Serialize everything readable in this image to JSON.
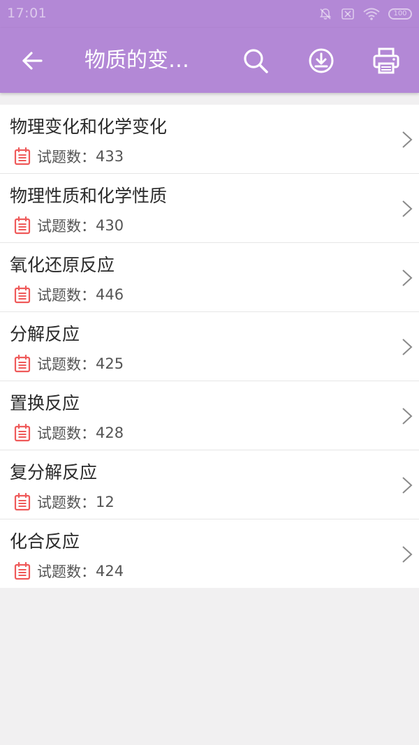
{
  "status_bar": {
    "time": "17:01",
    "battery_level": "100",
    "icons": [
      "notifications-off-icon",
      "sim-off-icon",
      "wifi-icon",
      "battery-icon"
    ]
  },
  "toolbar": {
    "back_icon": "arrow-back-icon",
    "title": "物质的变…",
    "actions": [
      {
        "name": "search-button",
        "icon": "search-icon"
      },
      {
        "name": "download-button",
        "icon": "download-icon"
      },
      {
        "name": "print-button",
        "icon": "print-icon"
      }
    ]
  },
  "list": {
    "count_label": "试题数：",
    "items": [
      {
        "title": "物理变化和化学变化",
        "count": "433"
      },
      {
        "title": "物理性质和化学性质",
        "count": "430"
      },
      {
        "title": "氧化还原反应",
        "count": "446"
      },
      {
        "title": "分解反应",
        "count": "425"
      },
      {
        "title": "置换反应",
        "count": "428"
      },
      {
        "title": "复分解反应",
        "count": "12"
      },
      {
        "title": "化合反应",
        "count": "424"
      }
    ]
  },
  "colors": {
    "primary": "#b388d6",
    "calendar_icon": "#ef5a5a",
    "background": "#f1f0f1"
  }
}
